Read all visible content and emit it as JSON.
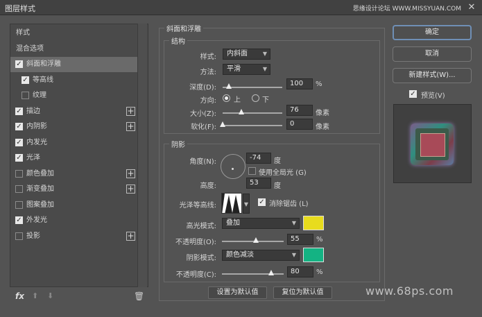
{
  "window": {
    "title": "图层样式",
    "watermark_top": "思缘设计论坛 WWW.MISSYUAN.COM",
    "watermark_bottom": "www.68ps.com",
    "close_glyph": "✕"
  },
  "sidebar": {
    "items": [
      {
        "label": "样式",
        "kind": "header"
      },
      {
        "label": "混合选项",
        "kind": "header"
      },
      {
        "label": "斜面和浮雕",
        "checked": true,
        "selected": true
      },
      {
        "label": "等高线",
        "checked": true,
        "sub": true
      },
      {
        "label": "纹理",
        "checked": false,
        "sub": true
      },
      {
        "label": "描边",
        "checked": true,
        "plus": true
      },
      {
        "label": "内阴影",
        "checked": true,
        "plus": true
      },
      {
        "label": "内发光",
        "checked": true
      },
      {
        "label": "光泽",
        "checked": true
      },
      {
        "label": "颜色叠加",
        "checked": false,
        "plus": true
      },
      {
        "label": "渐变叠加",
        "checked": false,
        "plus": true
      },
      {
        "label": "图案叠加",
        "checked": false
      },
      {
        "label": "外发光",
        "checked": true
      },
      {
        "label": "投影",
        "checked": false,
        "plus": true
      }
    ],
    "footer": {
      "fx": "fx",
      "up": "⬆",
      "down": "⬇",
      "trash": "🗑"
    }
  },
  "bevel": {
    "group_title": "斜面和浮雕",
    "structure_title": "结构",
    "style_label": "样式:",
    "style_value": "内斜面",
    "technique_label": "方法:",
    "technique_value": "平滑",
    "depth_label": "深度(D):",
    "depth_value": "100",
    "depth_unit": "%",
    "depth_fraction": 0.1,
    "direction_label": "方向:",
    "dir_up": "上",
    "dir_down": "下",
    "size_label": "大小(Z):",
    "size_value": "76",
    "size_unit": "像素",
    "size_fraction": 0.31,
    "soften_label": "软化(F):",
    "soften_value": "0",
    "soften_unit": "像素",
    "soften_fraction": 0.0
  },
  "shading": {
    "title": "阴影",
    "angle_label": "角度(N):",
    "angle_value": "-74",
    "angle_unit": "度",
    "global_light_label": "使用全局光 (G)",
    "global_light": false,
    "altitude_label": "高度:",
    "altitude_value": "53",
    "altitude_unit": "度",
    "gloss_label": "光泽等高线:",
    "antialias_label": "消除锯齿 (L)",
    "antialias": true,
    "highlight_label": "高光模式:",
    "highlight_mode": "叠加",
    "highlight_color": "#e8dc1d",
    "hl_opacity_label": "不透明度(O):",
    "hl_opacity_value": "55",
    "hl_opacity_unit": "%",
    "hl_opacity_fraction": 0.55,
    "shadow_label": "阴影模式:",
    "shadow_mode": "颜色减淡",
    "shadow_color": "#14b383",
    "sh_opacity_label": "不透明度(C):",
    "sh_opacity_value": "80",
    "sh_opacity_unit": "%",
    "sh_opacity_fraction": 0.8
  },
  "buttons": {
    "make_default": "设置为默认值",
    "reset_default": "复位为默认值",
    "ok": "确定",
    "cancel": "取消",
    "new_style": "新建样式(W)...",
    "preview_label": "预览(V)",
    "preview": true
  }
}
